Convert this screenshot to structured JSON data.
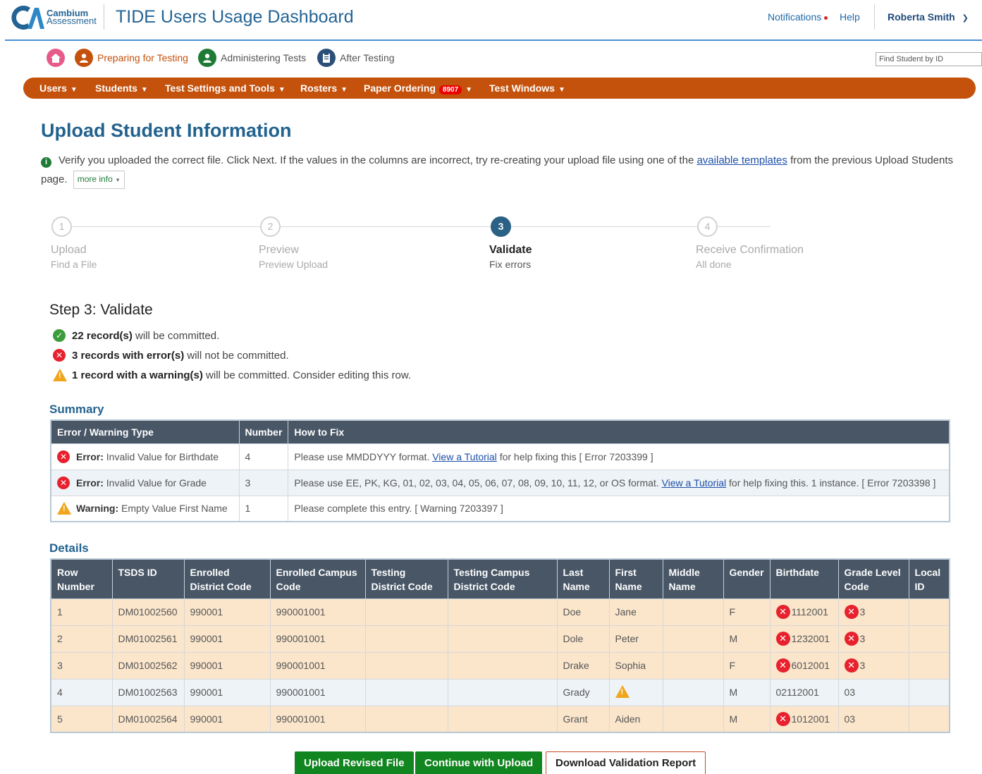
{
  "header": {
    "brand_line1": "Cambium",
    "brand_line2": "Assessment",
    "app_title": "TIDE Users Usage Dashboard",
    "notifications": "Notifications",
    "help": "Help",
    "user": "Roberta Smith"
  },
  "phases": {
    "preparing": "Preparing for Testing",
    "administering": "Administering Tests",
    "after": "After Testing"
  },
  "search": {
    "placeholder": "Find Student by ID"
  },
  "menu": {
    "users": "Users",
    "students": "Students",
    "test_settings": "Test Settings and Tools",
    "rosters": "Rosters",
    "paper_ordering": "Paper Ordering",
    "paper_badge": "8907",
    "test_windows": "Test Windows"
  },
  "page": {
    "title": "Upload Student Information",
    "info_before": "Verify you uploaded the correct file. Click Next. If the values in the columns are incorrect, try re-creating your upload file using one of the",
    "info_link": "available templates",
    "info_after": "from the previous Upload Students page.",
    "more_info": "more info"
  },
  "stepper": [
    {
      "num": "1",
      "title": "Upload",
      "sub": "Find a File"
    },
    {
      "num": "2",
      "title": "Preview",
      "sub": "Preview Upload"
    },
    {
      "num": "3",
      "title": "Validate",
      "sub": "Fix errors"
    },
    {
      "num": "4",
      "title": "Receive Confirmation",
      "sub": "All done"
    }
  ],
  "validate": {
    "heading": "Step 3: Validate",
    "ok_bold": "22 record(s)",
    "ok_rest": "will be committed.",
    "err_bold": "3 records with error(s)",
    "err_rest": "will not be committed.",
    "warn_bold": "1 record with a warning(s)",
    "warn_rest": "will be committed. Consider editing this row."
  },
  "summary": {
    "title": "Summary",
    "headers": {
      "type": "Error / Warning Type",
      "number": "Number",
      "fix": "How to Fix"
    },
    "rows": [
      {
        "kind": "Error:",
        "desc": "Invalid Value for Birthdate",
        "number": "4",
        "fix_before": "Please use MMDDYYY format.",
        "fix_link": "View a Tutorial",
        "fix_after": "for help fixing this [ Error 7203399 ]"
      },
      {
        "kind": "Error:",
        "desc": "Invalid Value for Grade",
        "number": "3",
        "fix_before": "Please use EE, PK, KG, 01, 02, 03, 04, 05, 06, 07, 08, 09, 10, 11, 12, or OS format.",
        "fix_link": "View a Tutorial",
        "fix_after": "for help fixing this. 1 instance. [ Error 7203398 ]"
      },
      {
        "kind": "Warning:",
        "desc": "Empty Value First Name",
        "number": "1",
        "fix_before": "Please complete this entry. [ Warning 7203397 ]"
      }
    ]
  },
  "details": {
    "title": "Details",
    "headers": [
      "Row Number",
      "TSDS ID",
      "Enrolled District Code",
      "Enrolled Campus Code",
      "Testing District Code",
      "Testing Campus District Code",
      "Last Name",
      "First Name",
      "Middle Name",
      "Gender",
      "Birthdate",
      "Grade Level Code",
      "Local ID"
    ],
    "rows": [
      {
        "row": "1",
        "tsds": "DM01002560",
        "edc": "990001",
        "ecc": "990001001",
        "tdc": "",
        "tcdc": "",
        "last": "Doe",
        "first": "Jane",
        "middle": "",
        "gender": "F",
        "birth": "1112001",
        "grade": "3",
        "local": ""
      },
      {
        "row": "2",
        "tsds": "DM01002561",
        "edc": "990001",
        "ecc": "990001001",
        "tdc": "",
        "tcdc": "",
        "last": "Dole",
        "first": "Peter",
        "middle": "",
        "gender": "M",
        "birth": "1232001",
        "grade": "3",
        "local": ""
      },
      {
        "row": "3",
        "tsds": "DM01002562",
        "edc": "990001",
        "ecc": "990001001",
        "tdc": "",
        "tcdc": "",
        "last": "Drake",
        "first": "Sophia",
        "middle": "",
        "gender": "F",
        "birth": "6012001",
        "grade": "3",
        "local": ""
      },
      {
        "row": "4",
        "tsds": "DM01002563",
        "edc": "990001",
        "ecc": "990001001",
        "tdc": "",
        "tcdc": "",
        "last": "Grady",
        "first": "",
        "middle": "",
        "gender": "M",
        "birth": "02112001",
        "grade": "03",
        "local": ""
      },
      {
        "row": "5",
        "tsds": "DM01002564",
        "edc": "990001",
        "ecc": "990001001",
        "tdc": "",
        "tcdc": "",
        "last": "Grant",
        "first": "Aiden",
        "middle": "",
        "gender": "M",
        "birth": "1012001",
        "grade": "03",
        "local": ""
      }
    ]
  },
  "buttons": {
    "upload_revised": "Upload Revised File",
    "continue": "Continue with Upload",
    "download": "Download Validation Report"
  },
  "colors": {
    "brand_blue": "#236495",
    "menu_orange": "#c4510c",
    "error_red": "#e8212e",
    "warning_orange": "#f0a51c",
    "ok_green": "#3c9c3c",
    "button_green": "#11851f",
    "table_header": "#485666",
    "error_row": "#fbe6cc"
  }
}
